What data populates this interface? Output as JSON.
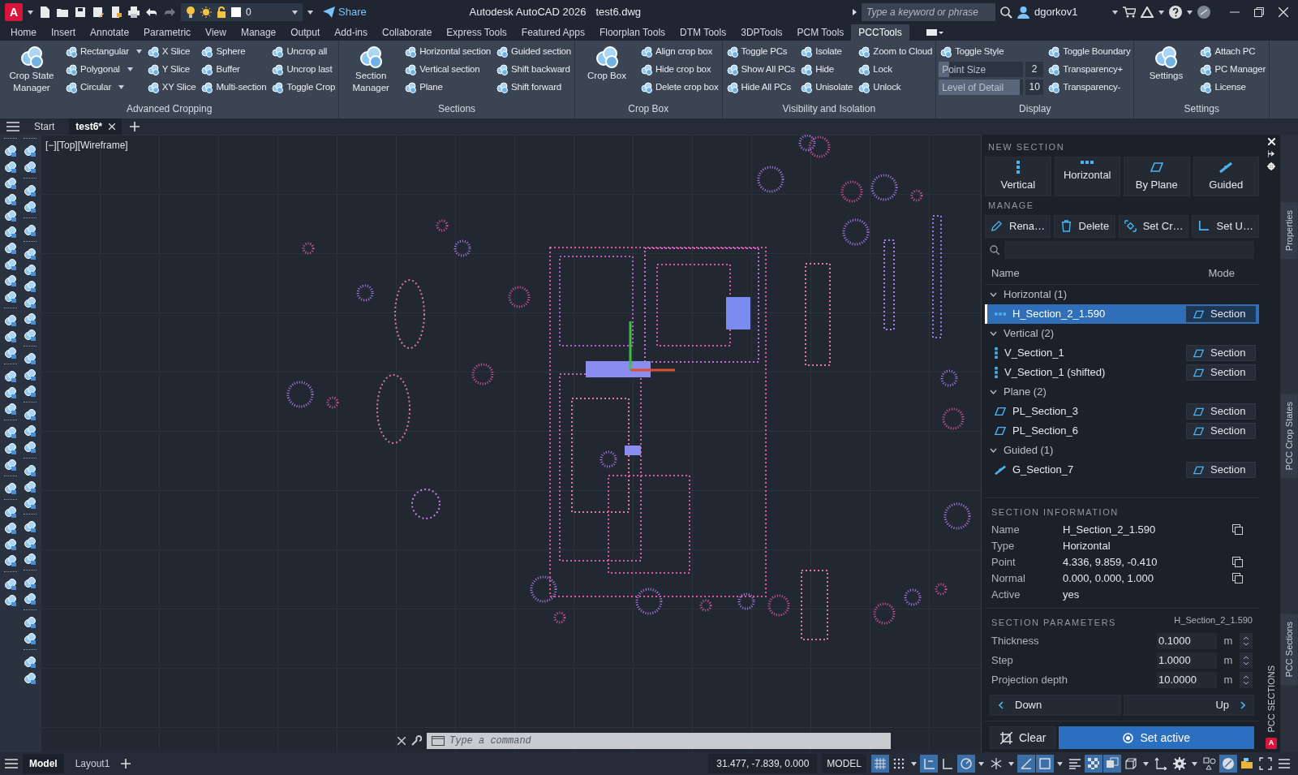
{
  "title_bar": {
    "logo": "A",
    "layer": "0",
    "share": "Share",
    "app_title": "Autodesk AutoCAD 2026",
    "file_name": "test6.dwg",
    "search": {
      "placeholder": "Type a keyword or phrase"
    },
    "user": "dgorkov1"
  },
  "ribbon_tabs": [
    {
      "label": "Home",
      "selected": false
    },
    {
      "label": "Insert",
      "selected": false
    },
    {
      "label": "Annotate",
      "selected": false
    },
    {
      "label": "Parametric",
      "selected": false
    },
    {
      "label": "View",
      "selected": false
    },
    {
      "label": "Manage",
      "selected": false
    },
    {
      "label": "Output",
      "selected": false
    },
    {
      "label": "Add-ins",
      "selected": false
    },
    {
      "label": "Collaborate",
      "selected": false
    },
    {
      "label": "Express Tools",
      "selected": false
    },
    {
      "label": "Featured Apps",
      "selected": false
    },
    {
      "label": "Floorplan Tools",
      "selected": false
    },
    {
      "label": "DTM Tools",
      "selected": false
    },
    {
      "label": "3DPTools",
      "selected": false
    },
    {
      "label": "PCM Tools",
      "selected": false
    },
    {
      "label": "PCCTools",
      "selected": true
    }
  ],
  "ribbon_panels": [
    {
      "title": "Advanced Cropping",
      "large": "Crop State Manager",
      "columns": [
        [
          {
            "kind": "button",
            "label": "Rectangular",
            "dropdown": true
          },
          {
            "kind": "button",
            "label": "Polygonal",
            "dropdown": true
          },
          {
            "kind": "button",
            "label": "Circular",
            "dropdown": true
          }
        ],
        [
          {
            "kind": "button",
            "label": "X Slice",
            "dropdown": false
          },
          {
            "kind": "button",
            "label": "Y Slice",
            "dropdown": false
          },
          {
            "kind": "button",
            "label": "XY Slice",
            "dropdown": false
          }
        ],
        [
          {
            "kind": "button",
            "label": "Sphere",
            "dropdown": false
          },
          {
            "kind": "button",
            "label": "Buffer",
            "dropdown": false
          },
          {
            "kind": "button",
            "label": "Multi-section",
            "dropdown": false
          }
        ],
        [
          {
            "kind": "button",
            "label": "Uncrop all",
            "dropdown": false
          },
          {
            "kind": "button",
            "label": "Uncrop last",
            "dropdown": false
          },
          {
            "kind": "button",
            "label": "Toggle Crop",
            "dropdown": false
          }
        ]
      ]
    },
    {
      "title": "Sections",
      "large": "Section Manager",
      "columns": [
        [
          {
            "kind": "button",
            "label": "Horizontal section",
            "dropdown": false
          },
          {
            "kind": "button",
            "label": "Vertical section",
            "dropdown": false
          },
          {
            "kind": "button",
            "label": "Plane",
            "dropdown": false
          }
        ],
        [
          {
            "kind": "button",
            "label": "Guided section",
            "dropdown": false
          },
          {
            "kind": "button",
            "label": "Shift backward",
            "dropdown": false
          },
          {
            "kind": "button",
            "label": "Shift forward",
            "dropdown": false
          }
        ]
      ]
    },
    {
      "title": "Crop Box",
      "large": "Crop Box",
      "columns": [
        [
          {
            "kind": "button",
            "label": "Align crop box",
            "dropdown": false
          },
          {
            "kind": "button",
            "label": "Hide crop box",
            "dropdown": false
          },
          {
            "kind": "button",
            "label": "Delete crop box",
            "dropdown": false
          }
        ]
      ]
    },
    {
      "title": "Visibility and Isolation",
      "columns": [
        [
          {
            "kind": "button",
            "label": "Toggle PCs",
            "dropdown": false
          },
          {
            "kind": "button",
            "label": "Show All PCs",
            "dropdown": false
          },
          {
            "kind": "button",
            "label": "Hide All PCs",
            "dropdown": false
          }
        ],
        [
          {
            "kind": "button",
            "label": "Isolate",
            "dropdown": false
          },
          {
            "kind": "button",
            "label": "Hide",
            "dropdown": false
          },
          {
            "kind": "button",
            "label": "Unisolate",
            "dropdown": false
          }
        ],
        [
          {
            "kind": "button",
            "label": "Zoom to Cloud",
            "dropdown": false
          },
          {
            "kind": "button",
            "label": "Lock",
            "dropdown": false
          },
          {
            "kind": "button",
            "label": "Unlock",
            "dropdown": false
          }
        ]
      ]
    },
    {
      "title": "Display",
      "columns": [
        [
          {
            "kind": "button",
            "label": "Toggle Style",
            "dropdown": false
          },
          {
            "kind": "slider",
            "label": "Point Size",
            "value": "2",
            "level": 0.12
          },
          {
            "kind": "slider",
            "label": "Level of Detail",
            "value": "10",
            "level": 0.96
          }
        ],
        [
          {
            "kind": "button",
            "label": "Toggle Boundary",
            "dropdown": false
          },
          {
            "kind": "button",
            "label": "Transparency+",
            "dropdown": false
          },
          {
            "kind": "button",
            "label": "Transparency-",
            "dropdown": false
          }
        ]
      ]
    },
    {
      "title": "Settings",
      "large": "Settings",
      "columns": [
        [
          {
            "kind": "button",
            "label": "Attach PC",
            "dropdown": false
          },
          {
            "kind": "button",
            "label": "PC Manager",
            "dropdown": false
          },
          {
            "kind": "button",
            "label": "License",
            "dropdown": false
          }
        ]
      ]
    }
  ],
  "doc_tabs": [
    {
      "label": "Start",
      "selected": false
    },
    {
      "label": "test6*",
      "selected": true
    }
  ],
  "viewport": {
    "label": "[−][Top][Wireframe]"
  },
  "command_line": {
    "placeholder": "Type a command"
  },
  "section_panel": {
    "title": "PCC SECTIONS",
    "logo": "A",
    "new_section": {
      "heading": "NEW SECTION",
      "buttons": [
        {
          "kind": "vertical",
          "label": "Vertical"
        },
        {
          "kind": "horizontal",
          "label": "Horizontal"
        },
        {
          "kind": "plane",
          "label": "By Plane"
        },
        {
          "kind": "guided",
          "label": "Guided"
        }
      ]
    },
    "manage": {
      "heading": "MANAGE",
      "buttons": [
        {
          "kind": "rename",
          "label": "Rena…"
        },
        {
          "kind": "delete",
          "label": "Delete"
        },
        {
          "kind": "crop",
          "label": "Set Cr…"
        },
        {
          "kind": "ucs",
          "label": "Set U…"
        }
      ]
    },
    "columns": [
      "Name",
      "Mode"
    ],
    "groups": [
      {
        "kind": "horizontal",
        "label": "Horizontal (1)",
        "expanded": true,
        "children": [
          {
            "name": "H_Section_2_1.590",
            "mode": "Section",
            "selected": true
          }
        ]
      },
      {
        "kind": "vertical",
        "label": "Vertical (2)",
        "expanded": true,
        "children": [
          {
            "name": "V_Section_1",
            "mode": "Section",
            "selected": false
          },
          {
            "name": "V_Section_1 (shifted)",
            "mode": "Section",
            "selected": false
          }
        ]
      },
      {
        "kind": "plane",
        "label": "Plane (2)",
        "expanded": true,
        "children": [
          {
            "name": "PL_Section_3",
            "mode": "Section",
            "selected": false
          },
          {
            "name": "PL_Section_6",
            "mode": "Section",
            "selected": false
          }
        ]
      },
      {
        "kind": "guided",
        "label": "Guided (1)",
        "expanded": true,
        "children": [
          {
            "name": "G_Section_7",
            "mode": "Section",
            "selected": false
          }
        ]
      }
    ],
    "info": {
      "heading": "SECTION INFORMATION",
      "rows": [
        {
          "label": "Name",
          "value": "H_Section_2_1.590",
          "copy": true
        },
        {
          "label": "Type",
          "value": "Horizontal",
          "copy": false
        },
        {
          "label": "Point",
          "value": "4.336, 9.859, -0.410",
          "copy": true
        },
        {
          "label": "Normal",
          "value": "0.000, 0.000, 1.000",
          "copy": true
        },
        {
          "label": "Active",
          "value": "yes",
          "copy": false
        }
      ]
    },
    "parameters": {
      "heading": "SECTION PARAMETERS",
      "section": "H_Section_2_1.590",
      "rows": [
        {
          "label": "Thickness",
          "value": "0.1000",
          "unit": "m"
        },
        {
          "label": "Step",
          "value": "1.0000",
          "unit": "m"
        },
        {
          "label": "Projection depth",
          "value": "10.0000",
          "unit": "m"
        }
      ]
    },
    "step_buttons": [
      {
        "kind": "down",
        "label": "Down"
      },
      {
        "kind": "up",
        "label": "Up"
      }
    ],
    "actions": [
      {
        "kind": "clear",
        "label": "Clear"
      },
      {
        "kind": "primary",
        "label": "Set active"
      }
    ]
  },
  "side_tabs": [
    "Properties",
    "PCC Crop States",
    "PCC Sections"
  ],
  "status_bar": {
    "layout_tabs": [
      {
        "label": "Model",
        "selected": true
      },
      {
        "label": "Layout1",
        "selected": false
      }
    ],
    "coordinates": "31.477, -7.839, 0.000",
    "space": "MODEL",
    "toggles": [
      {
        "kind": "grid",
        "on": true,
        "dropdown": false
      },
      {
        "kind": "snap",
        "on": false,
        "dropdown": true
      },
      {
        "kind": "infer",
        "on": true,
        "dropdown": false
      },
      {
        "kind": "ortho",
        "on": false,
        "dropdown": false
      },
      {
        "kind": "polar",
        "on": true,
        "dropdown": true
      },
      {
        "kind": "isodraft",
        "on": false,
        "dropdown": true
      },
      {
        "kind": "track",
        "on": true,
        "dropdown": false
      },
      {
        "kind": "osnap",
        "on": true,
        "dropdown": true
      },
      {
        "kind": "lineweight",
        "on": false,
        "dropdown": false
      },
      {
        "kind": "transparency",
        "on": true,
        "dropdown": false
      },
      {
        "kind": "cycling",
        "on": true,
        "dropdown": false
      },
      {
        "kind": "gizmo",
        "on": false,
        "dropdown": true
      },
      {
        "kind": "ucs",
        "on": false,
        "dropdown": false
      },
      {
        "kind": "gear",
        "on": false,
        "dropdown": true
      },
      {
        "kind": "annotation",
        "on": false,
        "dropdown": false
      },
      {
        "kind": "isolate",
        "on": true,
        "dropdown": false
      },
      {
        "kind": "hardware",
        "on": false,
        "dropdown": false
      },
      {
        "kind": "fullscreen",
        "on": false,
        "dropdown": false
      },
      {
        "kind": "menu",
        "on": false,
        "dropdown": false
      }
    ]
  }
}
